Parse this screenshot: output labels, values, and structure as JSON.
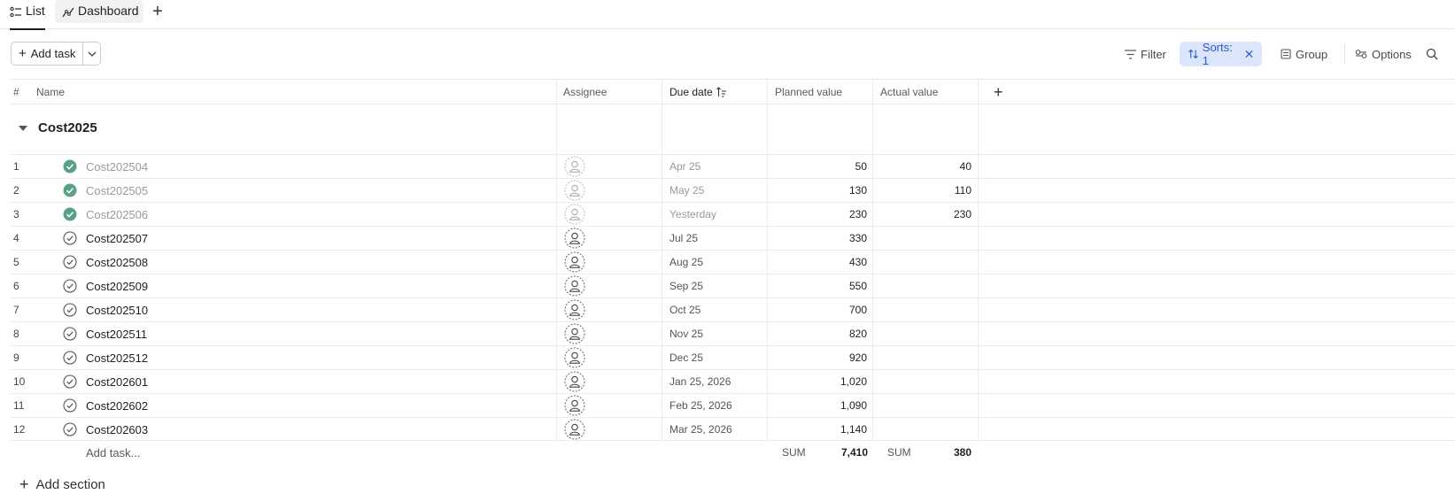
{
  "tabs": [
    {
      "label": "List",
      "icon": "list-icon"
    },
    {
      "label": "Dashboard",
      "icon": "chart-icon"
    }
  ],
  "toolbar": {
    "add_task_label": "Add task",
    "filter_label": "Filter",
    "sorts_label": "Sorts: 1",
    "group_label": "Group",
    "options_label": "Options"
  },
  "columns": {
    "num": "#",
    "name": "Name",
    "assignee": "Assignee",
    "due_date": "Due date",
    "planned": "Planned value",
    "actual": "Actual value"
  },
  "section": {
    "title": "Cost2025"
  },
  "rows": [
    {
      "num": "1",
      "name": "Cost202504",
      "due": "Apr 25",
      "planned": "50",
      "actual": "40",
      "done": true
    },
    {
      "num": "2",
      "name": "Cost202505",
      "due": "May 25",
      "planned": "130",
      "actual": "110",
      "done": true
    },
    {
      "num": "3",
      "name": "Cost202506",
      "due": "Yesterday",
      "planned": "230",
      "actual": "230",
      "done": true
    },
    {
      "num": "4",
      "name": "Cost202507",
      "due": "Jul 25",
      "planned": "330",
      "actual": "",
      "done": false
    },
    {
      "num": "5",
      "name": "Cost202508",
      "due": "Aug 25",
      "planned": "430",
      "actual": "",
      "done": false
    },
    {
      "num": "6",
      "name": "Cost202509",
      "due": "Sep 25",
      "planned": "550",
      "actual": "",
      "done": false
    },
    {
      "num": "7",
      "name": "Cost202510",
      "due": "Oct 25",
      "planned": "700",
      "actual": "",
      "done": false
    },
    {
      "num": "8",
      "name": "Cost202511",
      "due": "Nov 25",
      "planned": "820",
      "actual": "",
      "done": false
    },
    {
      "num": "9",
      "name": "Cost202512",
      "due": "Dec 25",
      "planned": "920",
      "actual": "",
      "done": false
    },
    {
      "num": "10",
      "name": "Cost202601",
      "due": "Jan 25, 2026",
      "planned": "1,020",
      "actual": "",
      "done": false
    },
    {
      "num": "11",
      "name": "Cost202602",
      "due": "Feb 25, 2026",
      "planned": "1,090",
      "actual": "",
      "done": false
    },
    {
      "num": "12",
      "name": "Cost202603",
      "due": "Mar 25, 2026",
      "planned": "1,140",
      "actual": "",
      "done": false
    }
  ],
  "footer": {
    "add_task": "Add task...",
    "sum_label": "SUM",
    "planned_sum": "7,410",
    "actual_sum": "380",
    "add_section": "Add section"
  },
  "colors": {
    "accent_blue": "#dbe5fc",
    "accent_blue_text": "#2b55c9",
    "done_green": "#58a182"
  }
}
